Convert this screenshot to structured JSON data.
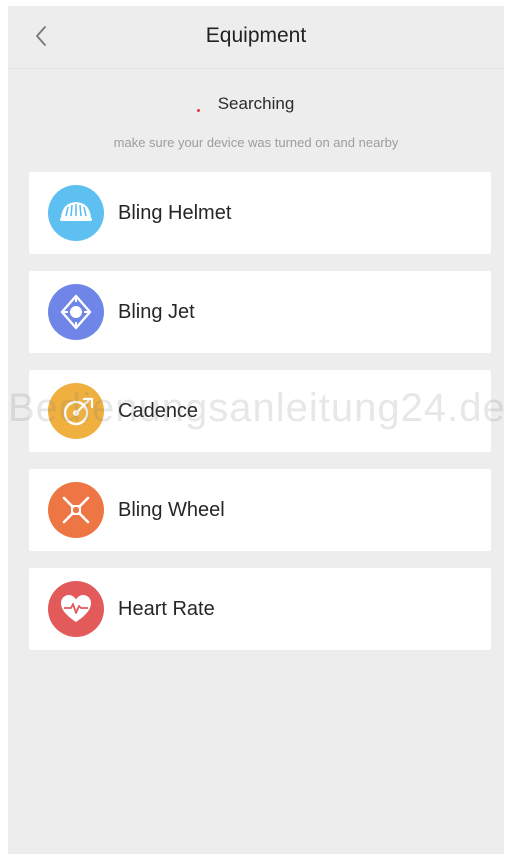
{
  "header": {
    "title": "Equipment",
    "back_icon": "chevron-left-icon"
  },
  "status": {
    "label": "Searching",
    "hint": "make sure your device was turned on and nearby"
  },
  "devices": [
    {
      "label": "Bling Helmet",
      "icon": "helmet-icon",
      "color": "#5ec0f0"
    },
    {
      "label": "Bling Jet",
      "icon": "jet-icon",
      "color": "#6f86e8"
    },
    {
      "label": "Cadence",
      "icon": "cadence-icon",
      "color": "#f0b040"
    },
    {
      "label": "Bling Wheel",
      "icon": "wheel-icon",
      "color": "#ee7645"
    },
    {
      "label": "Heart Rate",
      "icon": "heart-rate-icon",
      "color": "#e25a5a"
    }
  ],
  "watermark": "Bedienungsanleitung24.de"
}
